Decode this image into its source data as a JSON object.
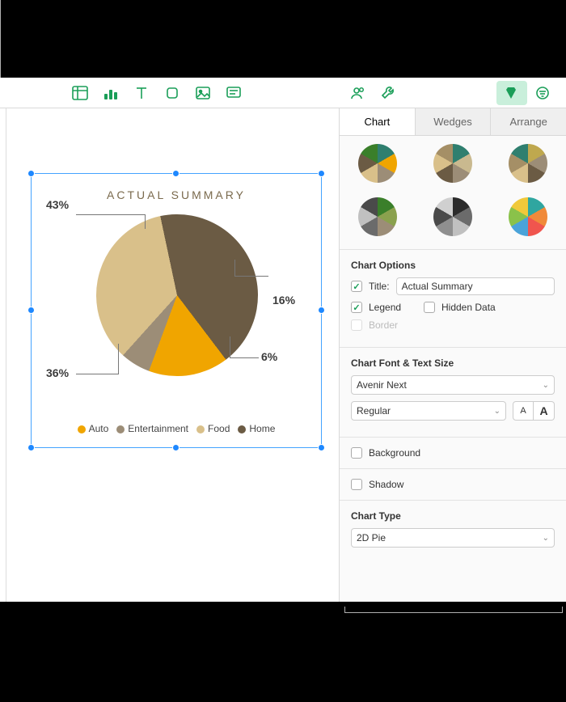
{
  "toolbar": {
    "icons": [
      "table",
      "chart",
      "text",
      "shape",
      "media",
      "comment",
      "collab",
      "wrench",
      "format",
      "sidebar"
    ]
  },
  "inspector": {
    "tabs": [
      "Chart",
      "Wedges",
      "Arrange"
    ],
    "active_tab": 0,
    "chart_options_heading": "Chart Options",
    "title_label": "Title:",
    "title_value": "Actual Summary",
    "legend_label": "Legend",
    "hidden_data_label": "Hidden Data",
    "border_label": "Border",
    "font_heading": "Chart Font & Text Size",
    "font_family": "Avenir Next",
    "font_style": "Regular",
    "background_label": "Background",
    "shadow_label": "Shadow",
    "chart_type_heading": "Chart Type",
    "chart_type_value": "2D Pie",
    "checks": {
      "title": true,
      "legend": true,
      "hidden_data": false,
      "border": false,
      "background": false,
      "shadow": false
    }
  },
  "chart_data": {
    "type": "pie",
    "title": "ACTUAL SUMMARY",
    "series": [
      {
        "name": "Auto",
        "value": 16,
        "color": "#f0a500"
      },
      {
        "name": "Entertainment",
        "value": 6,
        "color": "#9c8d77"
      },
      {
        "name": "Food",
        "value": 36,
        "color": "#d9c08a"
      },
      {
        "name": "Home",
        "value": 43,
        "color": "#6b5b44"
      }
    ],
    "labels": {
      "Auto": "16%",
      "Entertainment": "6%",
      "Food": "36%",
      "Home": "43%"
    },
    "label_format": "percent"
  },
  "style_swatches": [
    [
      "#2f7f6f",
      "#f0a500",
      "#9c8d77",
      "#d9c08a",
      "#6b5b44",
      "#3a7f2a"
    ],
    [
      "#2f7f6f",
      "#c9b98f",
      "#9c8d77",
      "#6b5b44",
      "#d9c08a",
      "#a58f66"
    ],
    [
      "#bfa84e",
      "#9c8d77",
      "#6b5b44",
      "#d9c08a",
      "#a58f66",
      "#2f7f6f"
    ],
    [
      "#3a7f2a",
      "#8aa14e",
      "#9c8d77",
      "#6b6b6b",
      "#c0c0c0",
      "#4a4a4a"
    ],
    [
      "#2b2b2b",
      "#6b6b6b",
      "#c0c0c0",
      "#8f8f8f",
      "#4a4a4a",
      "#d0d0d0"
    ],
    [
      "#2fa6a0",
      "#f08a3a",
      "#f0554e",
      "#4aa3d9",
      "#8ac24a",
      "#f0c93a"
    ]
  ]
}
